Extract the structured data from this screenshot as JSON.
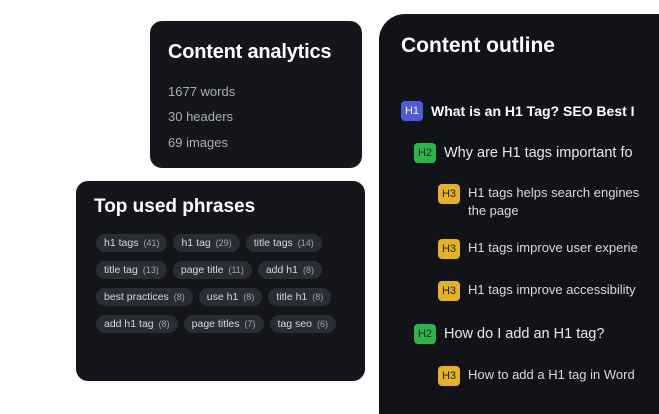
{
  "analytics": {
    "title": "Content analytics",
    "words": "1677 words",
    "headers": "30 headers",
    "images": "69 images"
  },
  "phrases": {
    "title": "Top used phrases",
    "items": [
      {
        "label": "h1 tags",
        "count": "(41)"
      },
      {
        "label": "h1 tag",
        "count": "(29)"
      },
      {
        "label": "title tags",
        "count": "(14)"
      },
      {
        "label": "title tag",
        "count": "(13)"
      },
      {
        "label": "page title",
        "count": "(11)"
      },
      {
        "label": "add h1",
        "count": "(8)"
      },
      {
        "label": "best practices",
        "count": "(8)"
      },
      {
        "label": "use h1",
        "count": "(8)"
      },
      {
        "label": "title h1",
        "count": "(8)"
      },
      {
        "label": "add h1 tag",
        "count": "(8)"
      },
      {
        "label": "page titles",
        "count": "(7)"
      },
      {
        "label": "tag seo",
        "count": "(6)"
      }
    ]
  },
  "outline": {
    "title": "Content outline",
    "items": [
      {
        "level": "H1",
        "text": "What is an H1 Tag? SEO Best I"
      },
      {
        "level": "H2",
        "text": "Why are H1 tags important fo"
      },
      {
        "level": "H3",
        "text": "H1 tags helps search engines",
        "text2": "the page"
      },
      {
        "level": "H3",
        "text": "H1 tags improve user experie"
      },
      {
        "level": "H3",
        "text": "H1 tags improve accessibility"
      },
      {
        "level": "H2",
        "text": "How do I add an H1 tag?"
      },
      {
        "level": "H3",
        "text": "How to add a H1 tag in Word"
      }
    ]
  },
  "colors": {
    "card_bg": "#14161c",
    "h1_badge": "#4f5bd9",
    "h2_badge": "#2eb44f",
    "h3_badge": "#e3b228"
  }
}
